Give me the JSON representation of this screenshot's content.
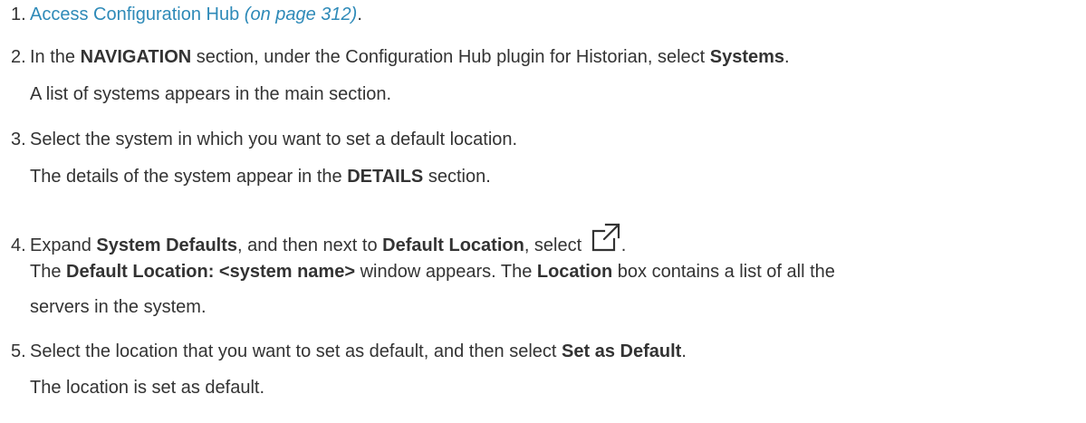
{
  "steps": [
    {
      "number": "1.",
      "link_text": "Access Configuration Hub",
      "page_ref": "(on page 312)",
      "trailing": "."
    },
    {
      "number": "2.",
      "parts": [
        "In the ",
        "NAVIGATION",
        " section, under the Configuration Hub plugin for Historian, select ",
        "Systems",
        "."
      ],
      "result": "A list of systems appears in the main section."
    },
    {
      "number": "3.",
      "text": "Select the system in which you want to set a default location.",
      "result_parts": [
        "The details of the system appear in the ",
        "DETAILS",
        " section."
      ]
    },
    {
      "number": "4.",
      "parts": [
        "Expand ",
        "System Defaults",
        ", and then next to ",
        "Default Location",
        ", select "
      ],
      "icon": "open-in-new-window-icon",
      "trailing": ".",
      "result_parts_line1": [
        "The ",
        "Default Location: <system name>",
        " window appears. The ",
        "Location",
        " box contains a list of all the"
      ],
      "result_line2": "servers in the system."
    },
    {
      "number": "5.",
      "parts": [
        "Select the location that you want to set as default, and then select ",
        "Set as Default",
        "."
      ],
      "result": "The location is set as default."
    }
  ]
}
